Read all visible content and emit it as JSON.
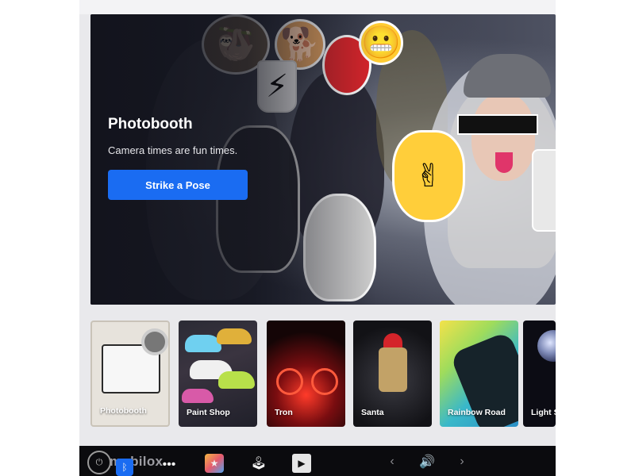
{
  "hero": {
    "title": "Photobooth",
    "subtitle": "Camera times are fun times.",
    "button_label": "Strike a Pose"
  },
  "carousel": {
    "items": [
      {
        "label": "Photobooth"
      },
      {
        "label": "Paint Shop"
      },
      {
        "label": "Tron"
      },
      {
        "label": "Santa"
      },
      {
        "label": "Rainbow Road"
      },
      {
        "label": "Light S"
      }
    ]
  },
  "taskbar": {
    "brand": "mobilox",
    "icons": [
      "power-icon",
      "bluetooth-icon",
      "more-icon",
      "toybox-icon",
      "arcade-icon",
      "theater-icon",
      "chevron-left-icon",
      "volume-icon",
      "chevron-right-icon"
    ]
  },
  "colors": {
    "accent": "#1a6cf2",
    "taskbar": "#0b0b0e"
  }
}
